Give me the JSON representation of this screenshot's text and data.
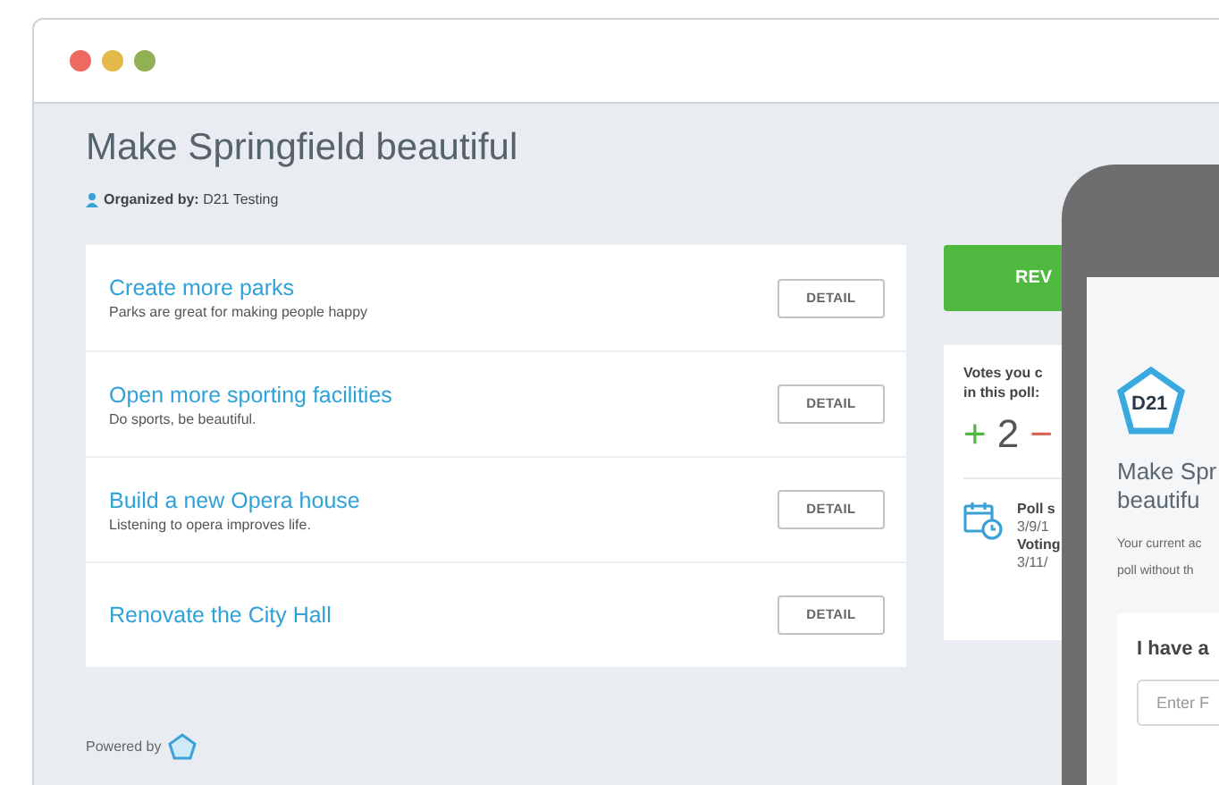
{
  "window": {
    "controls": [
      {
        "color": "#ee6a61"
      },
      {
        "color": "#e4b84a"
      },
      {
        "color": "#8fb153"
      }
    ]
  },
  "page": {
    "title": "Make Springfield beautiful",
    "organizer_label": "Organized by:",
    "organizer": "D21 Testing"
  },
  "proposals": [
    {
      "title": "Create more parks",
      "description": "Parks are great for making people happy",
      "button": "DETAIL"
    },
    {
      "title": "Open more sporting facilities",
      "description": "Do sports, be beautiful.",
      "button": "DETAIL"
    },
    {
      "title": "Build a new Opera house",
      "description": "Listening to opera improves life.",
      "button": "DETAIL"
    },
    {
      "title": "Renovate the City Hall",
      "button": "DETAIL"
    }
  ],
  "side": {
    "button": "REV",
    "votes_lines": [
      "Votes you c",
      "in this poll:"
    ],
    "plus": "+",
    "count": "2",
    "minus": "−",
    "poll_lines": [
      {
        "text": "Poll s",
        "bold": true
      },
      {
        "text": "3/9/1",
        "bold": false
      },
      {
        "text": "Voting",
        "bold": true
      },
      {
        "text": "3/11/",
        "bold": false
      }
    ]
  },
  "footer": {
    "text": "Powered by"
  },
  "phone": {
    "logo": "D21",
    "title_lines": [
      "Make Spr",
      "beautifu"
    ],
    "note_lines": [
      "Your current ac",
      "poll without th"
    ],
    "card_title": "I have a",
    "input_placeholder": "Enter F"
  }
}
